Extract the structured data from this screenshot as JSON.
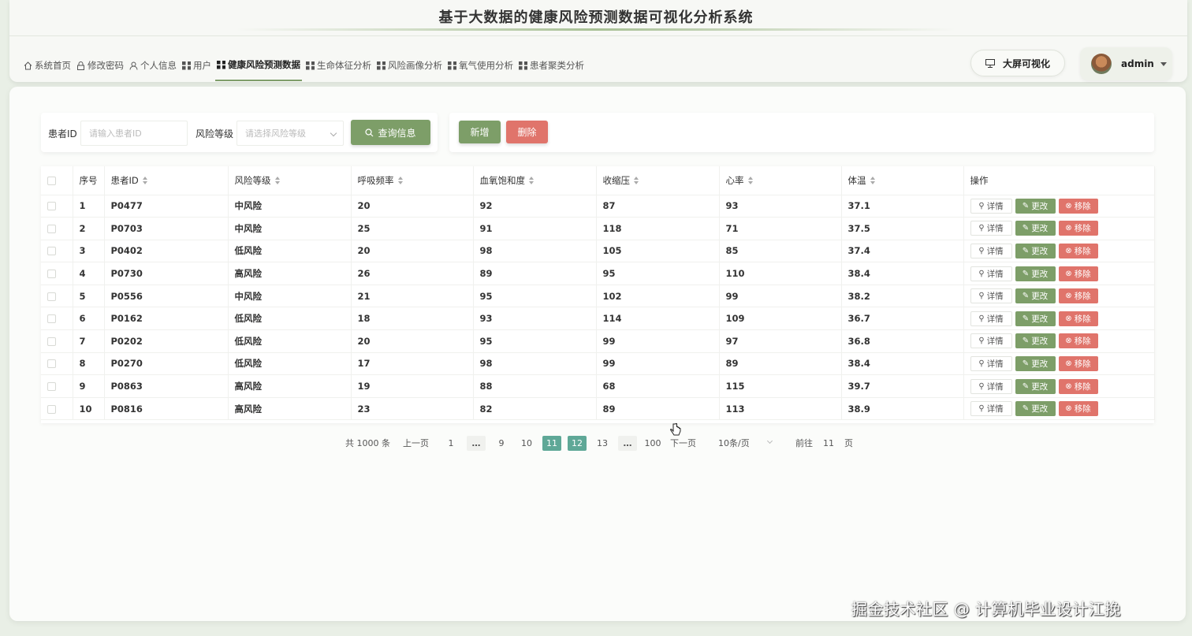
{
  "header": {
    "title": "基于大数据的健康风险预测数据可视化分析系统",
    "nav": [
      {
        "label": "系统首页",
        "icon": "home-icon"
      },
      {
        "label": "修改密码",
        "icon": "lock-icon"
      },
      {
        "label": "个人信息",
        "icon": "user-icon"
      },
      {
        "label": "用户",
        "icon": "grid-icon"
      },
      {
        "label": "健康风险预测数据",
        "icon": "grid-icon",
        "active": true
      },
      {
        "label": "生命体征分析",
        "icon": "grid-icon"
      },
      {
        "label": "风险画像分析",
        "icon": "grid-icon"
      },
      {
        "label": "氧气使用分析",
        "icon": "grid-icon"
      },
      {
        "label": "患者聚类分析",
        "icon": "grid-icon"
      }
    ],
    "bigscreen_label": "大屏可视化",
    "username": "admin"
  },
  "search": {
    "patient_label": "患者ID",
    "patient_placeholder": "请输入患者ID",
    "risk_label": "风险等级",
    "risk_placeholder": "请选择风险等级",
    "query_label": "查询信息"
  },
  "actions": {
    "add_label": "新增",
    "delete_label": "删除"
  },
  "table": {
    "columns": [
      "序号",
      "患者ID",
      "风险等级",
      "呼吸频率",
      "血氧饱和度",
      "收缩压",
      "心率",
      "体温",
      "操作"
    ],
    "rows": [
      [
        "1",
        "P0477",
        "中风险",
        "20",
        "92",
        "87",
        "93",
        "37.1"
      ],
      [
        "2",
        "P0703",
        "中风险",
        "25",
        "91",
        "118",
        "71",
        "37.5"
      ],
      [
        "3",
        "P0402",
        "低风险",
        "20",
        "98",
        "105",
        "85",
        "37.4"
      ],
      [
        "4",
        "P0730",
        "高风险",
        "26",
        "89",
        "95",
        "110",
        "38.4"
      ],
      [
        "5",
        "P0556",
        "中风险",
        "21",
        "95",
        "102",
        "99",
        "38.2"
      ],
      [
        "6",
        "P0162",
        "低风险",
        "18",
        "93",
        "114",
        "109",
        "36.7"
      ],
      [
        "7",
        "P0202",
        "低风险",
        "20",
        "95",
        "99",
        "97",
        "36.8"
      ],
      [
        "8",
        "P0270",
        "低风险",
        "17",
        "98",
        "99",
        "89",
        "38.4"
      ],
      [
        "9",
        "P0863",
        "高风险",
        "19",
        "88",
        "68",
        "115",
        "39.7"
      ],
      [
        "10",
        "P0816",
        "高风险",
        "23",
        "82",
        "89",
        "113",
        "38.9"
      ]
    ],
    "op_detail": "详情",
    "op_edit": "更改",
    "op_remove": "移除"
  },
  "pagination": {
    "total": "共 1000 条",
    "prev": "上一页",
    "pages": [
      "1",
      "…",
      "9",
      "10",
      "11",
      "12",
      "13",
      "…",
      "100"
    ],
    "active_page": "11",
    "next": "下一页",
    "page_size": "10条/页",
    "goto_prefix": "前往",
    "goto_value": "11",
    "goto_suffix": "页"
  },
  "watermark": "掘金技术社区 @ 计算机毕业设计江挽",
  "colors": {
    "primary_green": "#7d9e68",
    "danger_red": "#e0746b",
    "active_page": "#5fa897"
  }
}
